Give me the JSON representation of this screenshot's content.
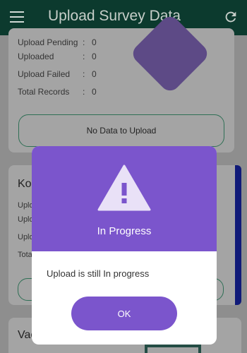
{
  "app_bar": {
    "title": "Upload Survey Data",
    "menu_icon": "hamburger-menu-icon",
    "refresh_icon": "refresh-icon",
    "color": "#0c3a2e"
  },
  "summary_card": {
    "rows": [
      {
        "label": "Upload Pending",
        "value": "0"
      },
      {
        "label": "Uploaded",
        "value": "0"
      },
      {
        "label": "Upload Failed",
        "value": "0"
      },
      {
        "label": "Total Records",
        "value": "0"
      }
    ],
    "separator": ":",
    "button_label": "No Data to Upload"
  },
  "card2": {
    "title": "Kol",
    "labels": [
      "Uplo",
      "Uplo",
      "Uplo",
      "Tota"
    ]
  },
  "card3": {
    "title": "Vac"
  },
  "dialog": {
    "icon": "warning-icon",
    "title": "In Progress",
    "message": "Upload is still In progress",
    "ok_label": "OK",
    "accent_color": "#7b55cc"
  }
}
